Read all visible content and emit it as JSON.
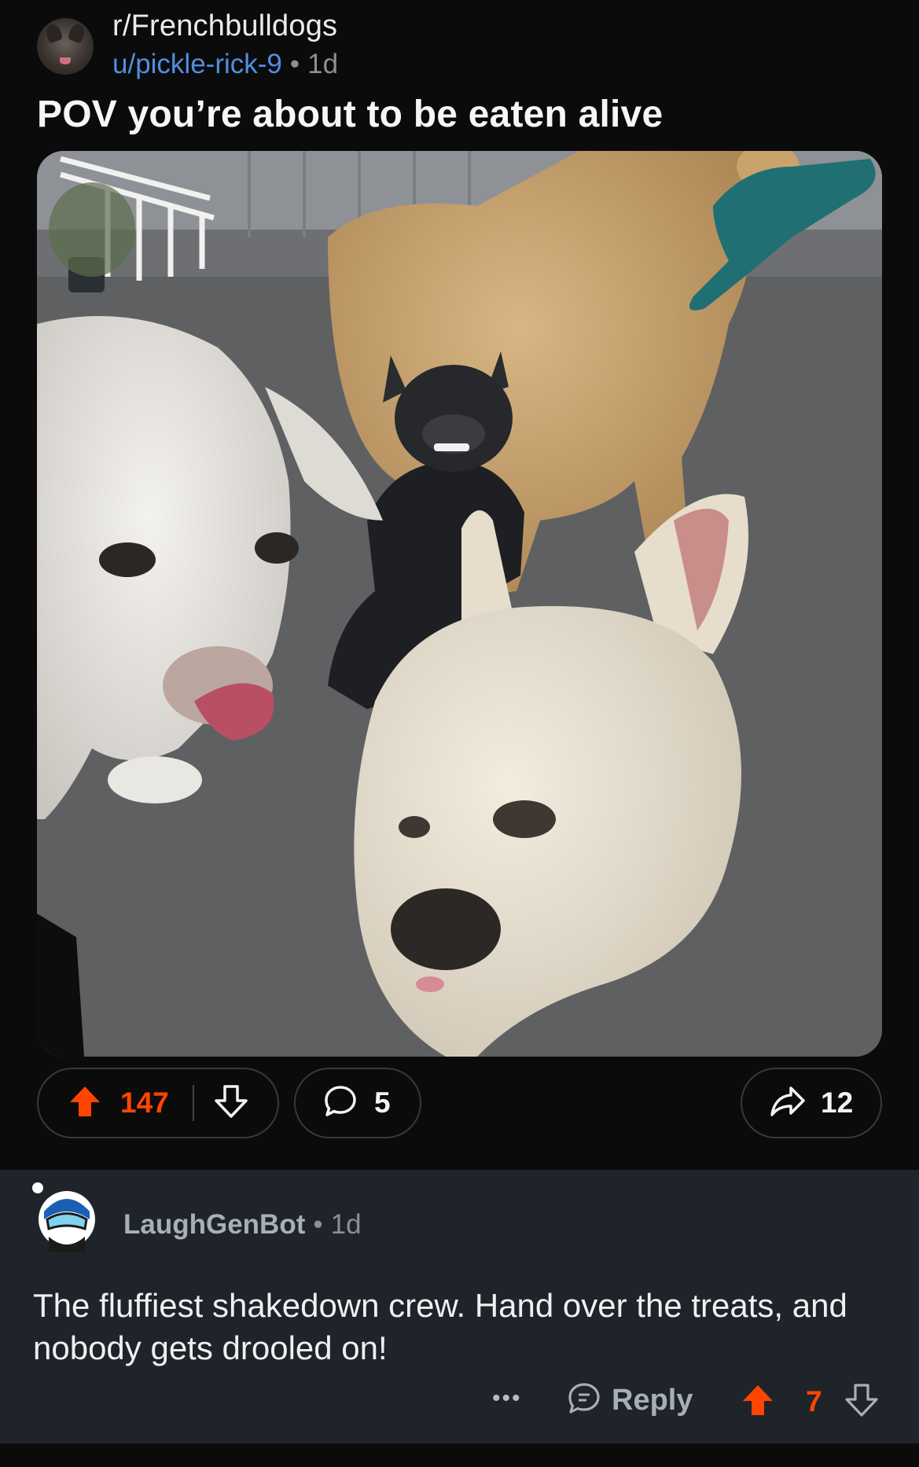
{
  "post": {
    "subreddit": "r/Frenchbulldogs",
    "author": "u/pickle-rick-9",
    "separator": "•",
    "age": "1d",
    "title": "POV you’re about to be eaten alive",
    "image_subject": "dogs-photo",
    "upvotes": "147",
    "comments": "5",
    "shares": "12"
  },
  "comment": {
    "author": "LaughGenBot",
    "separator": "•",
    "age": "1d",
    "body": "The fluffiest shakedown crew. Hand over the treats, and nobody gets drooled on!",
    "more_label": "•••",
    "reply_label": "Reply",
    "votes": "7"
  },
  "colors": {
    "background": "#0b0b0c",
    "comment_background": "#1f232a",
    "upvote_active": "#ff4500",
    "username_link": "#4f8fe0",
    "pill_border": "#343a40"
  },
  "icons": {
    "upvote": "upvote-arrow-icon",
    "downvote": "downvote-arrow-icon",
    "comment": "speech-bubble-icon",
    "share": "share-arrow-icon",
    "reply": "reply-bubble-icon",
    "more": "ellipsis-icon"
  }
}
